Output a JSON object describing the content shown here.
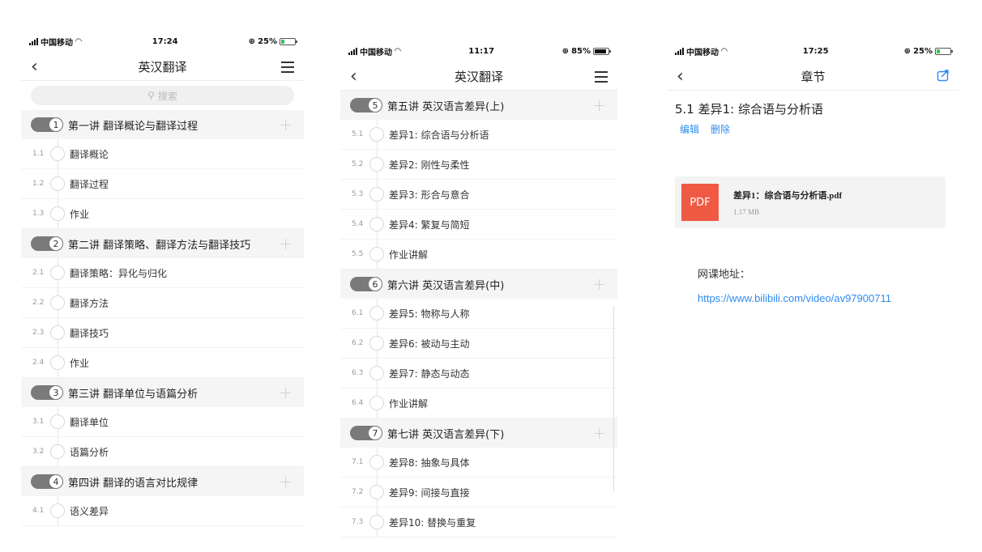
{
  "screen1": {
    "status": {
      "carrier": "中国移动",
      "time": "17:24",
      "battery": "25%"
    },
    "nav_title": "英汉翻译",
    "search_placeholder": "搜索",
    "lectures": [
      {
        "num": "1",
        "title": "第一讲 翻译概论与翻译过程",
        "lessons": [
          {
            "num": "1.1",
            "name": "翻译概论"
          },
          {
            "num": "1.2",
            "name": "翻译过程"
          },
          {
            "num": "1.3",
            "name": "作业"
          }
        ]
      },
      {
        "num": "2",
        "title": "第二讲 翻译策略、翻译方法与翻译技巧",
        "lessons": [
          {
            "num": "2.1",
            "name": "翻译策略：异化与归化"
          },
          {
            "num": "2.2",
            "name": "翻译方法"
          },
          {
            "num": "2.3",
            "name": "翻译技巧"
          },
          {
            "num": "2.4",
            "name": "作业"
          }
        ]
      },
      {
        "num": "3",
        "title": "第三讲 翻译单位与语篇分析",
        "lessons": [
          {
            "num": "3.1",
            "name": "翻译单位"
          },
          {
            "num": "3.2",
            "name": "语篇分析"
          }
        ]
      },
      {
        "num": "4",
        "title": "第四讲 翻译的语言对比规律",
        "lessons": [
          {
            "num": "4.1",
            "name": "语义差异"
          }
        ]
      }
    ]
  },
  "screen2": {
    "status": {
      "carrier": "中国移动",
      "time": "11:17",
      "battery": "85%"
    },
    "nav_title": "英汉翻译",
    "lectures": [
      {
        "num": "5",
        "title": "第五讲 英汉语言差异(上)",
        "lessons": [
          {
            "num": "5.1",
            "name": "差异1: 综合语与分析语"
          },
          {
            "num": "5.2",
            "name": "差异2: 刚性与柔性"
          },
          {
            "num": "5.3",
            "name": "差异3: 形合与意合"
          },
          {
            "num": "5.4",
            "name": "差异4: 繁复与简短"
          },
          {
            "num": "5.5",
            "name": "作业讲解"
          }
        ]
      },
      {
        "num": "6",
        "title": "第六讲 英汉语言差异(中)",
        "lessons": [
          {
            "num": "6.1",
            "name": "差异5: 物称与人称"
          },
          {
            "num": "6.2",
            "name": "差异6: 被动与主动"
          },
          {
            "num": "6.3",
            "name": "差异7: 静态与动态"
          },
          {
            "num": "6.4",
            "name": "作业讲解"
          }
        ]
      },
      {
        "num": "7",
        "title": "第七讲 英汉语言差异(下)",
        "lessons": [
          {
            "num": "7.1",
            "name": "差异8: 抽象与具体"
          },
          {
            "num": "7.2",
            "name": "差异9: 间接与直接"
          },
          {
            "num": "7.3",
            "name": "差异10: 替换与重复"
          }
        ]
      }
    ]
  },
  "screen3": {
    "status": {
      "carrier": "中国移动",
      "time": "17:25",
      "battery": "25%"
    },
    "nav_title": "章节",
    "chapter_title": "5.1 差异1: 综合语与分析语",
    "edit_label": "编辑",
    "delete_label": "删除",
    "file": {
      "badge": "PDF",
      "name": "差异1：综合语与分析语.pdf",
      "size": "1.17 MB"
    },
    "link_label": "网课地址：",
    "link_url": "https://www.bilibili.com/video/av97900711"
  },
  "colors": {
    "accent": "#2f8cf0",
    "pdf": "#f05a44",
    "toggle": "#7a7a7a"
  }
}
